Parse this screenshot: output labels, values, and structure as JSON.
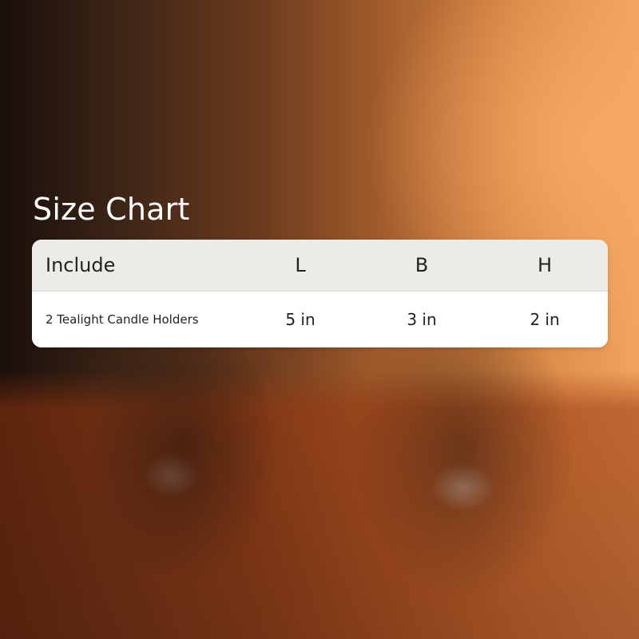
{
  "title": "Size Chart",
  "table": {
    "headers": [
      "Include",
      "L",
      "B",
      "H"
    ],
    "rows": [
      [
        "2 Tealight Candle Holders",
        "5 in",
        "3 in",
        "2 in"
      ]
    ]
  },
  "colors": {
    "header_bg": "#ecebe8",
    "row_bg": "#ffffff",
    "title_text": "#ffffff",
    "background_warm": "#d98846",
    "background_dark": "#1a0f0a"
  }
}
